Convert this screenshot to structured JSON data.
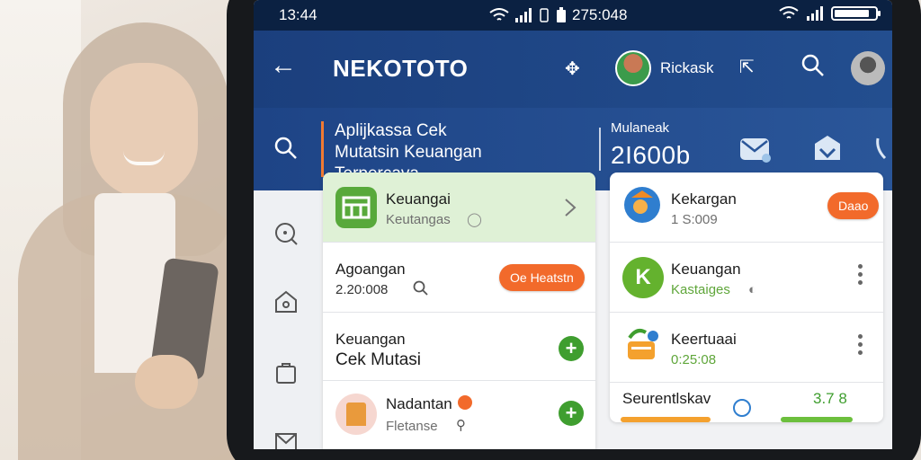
{
  "status_bar": {
    "time": "13:44",
    "center_text": "275:048"
  },
  "app_bar": {
    "title": "NEKOTOTO",
    "user_name": "Rickask"
  },
  "banner": {
    "line1": "Aplijkassa Cek",
    "line2": "Mutatsin Keuangan",
    "line3": "Terpercava",
    "label": "Mulaneak",
    "number": "2I600b"
  },
  "left_list": {
    "items": [
      {
        "title": "Keuangai",
        "subtitle": "Keutangas"
      },
      {
        "title": "Agoangan",
        "subtitle": "2.20:008",
        "chip": "Oe Heatstn"
      },
      {
        "title": "Keuangan",
        "subtitle": "Cek Mutasi"
      },
      {
        "title": "Nadantan",
        "subtitle": "Fletanse"
      }
    ]
  },
  "right_list": {
    "items": [
      {
        "title": "Kekargan",
        "subtitle": "1 S:009",
        "chip": "Daao"
      },
      {
        "title": "Keuangan",
        "subtitle": "Kastaiges"
      },
      {
        "title": "Keertuaai",
        "subtitle": "0:25:08"
      }
    ],
    "footer": {
      "label": "Seurentlskav",
      "value": "3.7 8"
    }
  },
  "colors": {
    "app_bar": "#1b3f7d",
    "accent_orange": "#f26a2b",
    "accent_green": "#3f9e2f"
  }
}
